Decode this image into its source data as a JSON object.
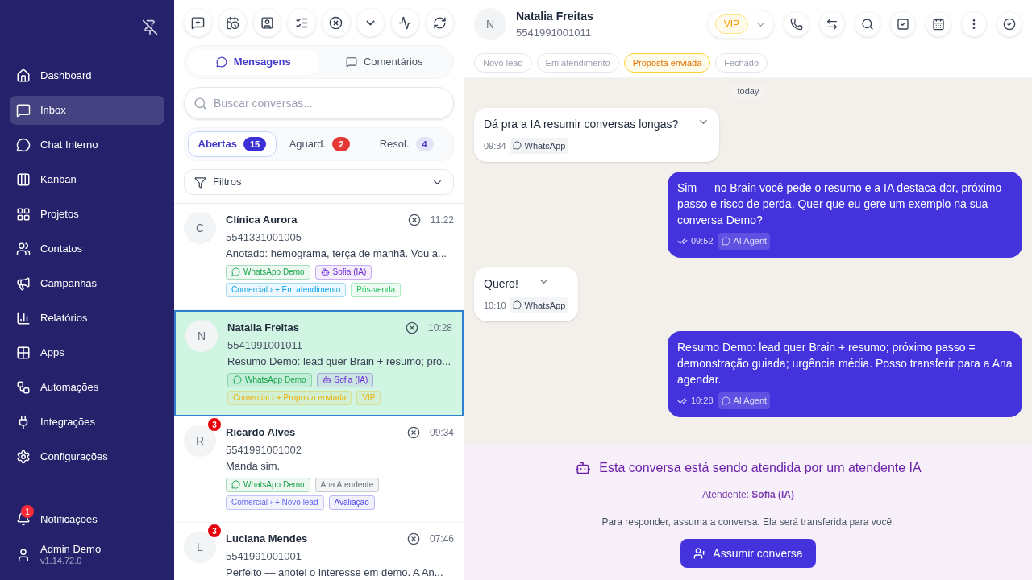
{
  "sidebar": {
    "items": [
      {
        "label": "Dashboard",
        "selected": false
      },
      {
        "label": "Inbox",
        "selected": true
      },
      {
        "label": "Chat Interno",
        "selected": false
      },
      {
        "label": "Kanban",
        "selected": false
      },
      {
        "label": "Projetos",
        "selected": false
      },
      {
        "label": "Contatos",
        "selected": false
      },
      {
        "label": "Campanhas",
        "selected": false
      },
      {
        "label": "Relatórios",
        "selected": false
      },
      {
        "label": "Apps",
        "selected": false
      },
      {
        "label": "Automações",
        "selected": false
      },
      {
        "label": "Integrações",
        "selected": false
      },
      {
        "label": "Configurações",
        "selected": false
      }
    ],
    "notifications": {
      "label": "Notificações",
      "count": "1"
    },
    "user": {
      "name": "Admin Demo",
      "version": "v1.14.72.0"
    }
  },
  "list": {
    "tabs": [
      {
        "label": "Mensagens",
        "selected": true
      },
      {
        "label": "Comentários",
        "selected": false
      }
    ],
    "search": {
      "placeholder": "Buscar conversas..."
    },
    "status_tabs": [
      {
        "label": "Abertas",
        "count": "15",
        "selected": true,
        "color": "#3b2fd6"
      },
      {
        "label": "Aguard.",
        "count": "2",
        "selected": false,
        "color": "#e53935"
      },
      {
        "label": "Resol.",
        "count": "4",
        "selected": false,
        "color": "#e4e3f7"
      }
    ],
    "filter": {
      "label": "Filtros"
    },
    "conversations": [
      {
        "initial": "C",
        "name": "Clínica Aurora",
        "phone": "5541331001005",
        "preview": "Anotado: hemograma, terça de manhã. Vou a...",
        "time": "11:22",
        "selected": false,
        "tags": [
          [
            {
              "kind": "channel",
              "text": "WhatsApp Demo",
              "color": "#16a34a"
            },
            {
              "kind": "agent",
              "text": "Sofia (IA)",
              "color": "#6d28d9"
            }
          ],
          [
            {
              "kind": "label",
              "text": "Comercial › + Em atendimento",
              "color": "#0ea5e9"
            },
            {
              "kind": "label",
              "text": "Pós-venda",
              "color": "#22c55e"
            }
          ]
        ]
      },
      {
        "initial": "N",
        "name": "Natalia Freitas",
        "phone": "5541991001011",
        "preview": "Resumo Demo: lead quer Brain + resumo; pró...",
        "time": "10:28",
        "selected": true,
        "tags": [
          [
            {
              "kind": "channel",
              "text": "WhatsApp Demo",
              "color": "#16a34a"
            },
            {
              "kind": "agent",
              "text": "Sofia (IA)",
              "color": "#6d28d9"
            }
          ],
          [
            {
              "kind": "label",
              "text": "Comercial › + Proposta enviada",
              "color": "#eab308"
            },
            {
              "kind": "label",
              "text": "VIP",
              "color": "#eab308"
            }
          ]
        ]
      },
      {
        "initial": "R",
        "name": "Ricardo Alves",
        "phone": "5541991001002",
        "preview": "Manda sim.",
        "time": "09:34",
        "unread": "3",
        "selected": false,
        "tags": [
          [
            {
              "kind": "channel",
              "text": "WhatsApp Demo",
              "color": "#16a34a"
            },
            {
              "kind": "label",
              "text": "Ana Atendente",
              "color": "#6b7280"
            }
          ],
          [
            {
              "kind": "label",
              "text": "Comercial › + Novo lead",
              "color": "#6366f1"
            },
            {
              "kind": "label",
              "text": "Avaliação",
              "color": "#4f46e5"
            }
          ]
        ]
      },
      {
        "initial": "L",
        "name": "Luciana Mendes",
        "phone": "5541991001001",
        "preview": "Perfeito — anotei o interesse em demo. A An...",
        "time": "07:46",
        "unread": "3",
        "selected": false
      }
    ]
  },
  "chat": {
    "contact": {
      "initial": "N",
      "name": "Natalia Freitas",
      "phone": "5541991001011",
      "tag": "VIP"
    },
    "stages": [
      {
        "label": "Novo lead",
        "selected": false
      },
      {
        "label": "Em atendimento",
        "selected": false
      },
      {
        "label": "Proposta enviada",
        "selected": true
      },
      {
        "label": "Fechado",
        "selected": false
      }
    ],
    "date": "today",
    "messages": [
      {
        "kind": "in",
        "text": "Dá pra a IA resumir conversas longas?",
        "time": "09:34",
        "source": "WhatsApp"
      },
      {
        "kind": "out",
        "text": "Sim — no Brain você pede o resumo e a IA destaca dor, próximo passo e risco de perda. Quer que eu gere um exemplo na sua conversa Demo?",
        "time": "09:52",
        "source": "AI Agent"
      },
      {
        "kind": "in",
        "text": "Quero!",
        "time": "10:10",
        "source": "WhatsApp"
      },
      {
        "kind": "out",
        "text": "Resumo Demo: lead quer Brain + resumo; próximo passo = demonstração guiada; urgência média. Posso transferir para a Ana agendar.",
        "time": "10:28",
        "source": "AI Agent"
      }
    ],
    "ai_notice": {
      "title": "Esta conversa está sendo atendida por um atendente IA",
      "agent_line": "Atendente: **Sofia (IA)**",
      "hint": "Para responder, assuma a conversa. Ela será transferida para você.",
      "button": "Assumir conversa"
    }
  }
}
